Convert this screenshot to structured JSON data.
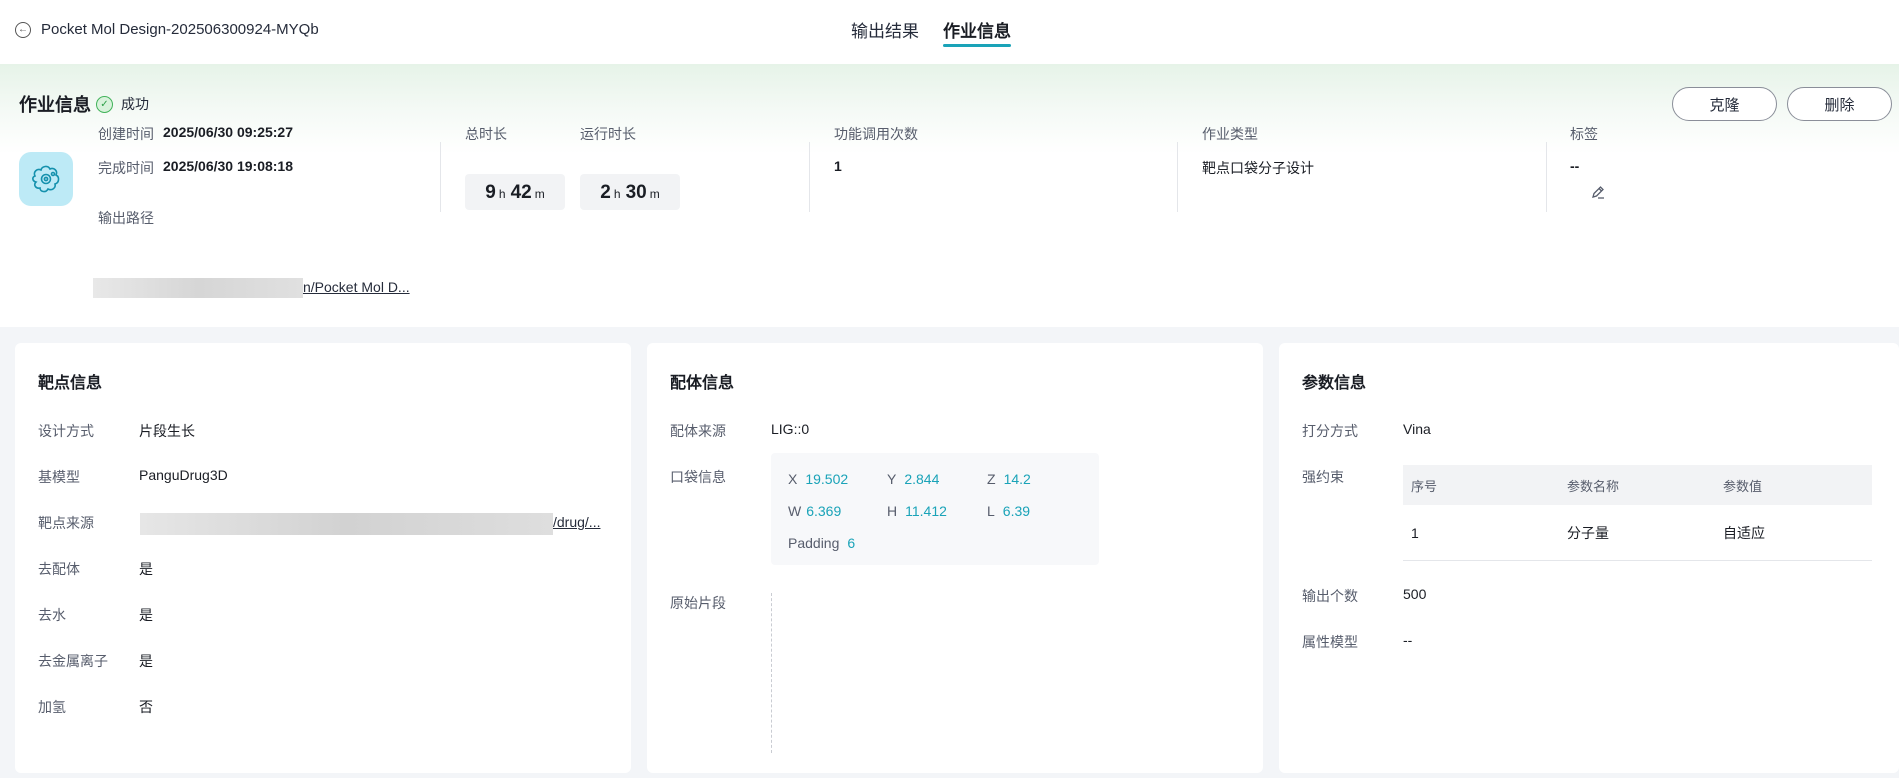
{
  "header": {
    "title": "Pocket Mol Design-202506300924-MYQb",
    "tabs": [
      {
        "label": "输出结果",
        "active": false
      },
      {
        "label": "作业信息",
        "active": true
      }
    ]
  },
  "job": {
    "title": "作业信息",
    "status": "成功",
    "actions": {
      "clone": "克隆",
      "delete": "删除"
    },
    "created_label": "创建时间",
    "created_value": "2025/06/30 09:25:27",
    "finished_label": "完成时间",
    "finished_value": "2025/06/30 19:08:18",
    "total_label": "总时长",
    "total": {
      "h": "9",
      "m": "42",
      "h_unit": "h",
      "m_unit": "m"
    },
    "run_label": "运行时长",
    "run": {
      "h": "2",
      "m": "30",
      "h_unit": "h",
      "m_unit": "m"
    },
    "calls_label": "功能调用次数",
    "calls_value": "1",
    "type_label": "作业类型",
    "type_value": "靶点口袋分子设计",
    "tag_label": "标签",
    "tag_value": "--",
    "output_label": "输出路径",
    "output_value": "n/Pocket Mol D..."
  },
  "target": {
    "title": "靶点信息",
    "rows": [
      {
        "label": "设计方式",
        "value": "片段生长"
      },
      {
        "label": "基模型",
        "value": "PanguDrug3D"
      },
      {
        "label": "靶点来源",
        "value": "/drug/..."
      },
      {
        "label": "去配体",
        "value": "是"
      },
      {
        "label": "去水",
        "value": "是"
      },
      {
        "label": "去金属离子",
        "value": "是"
      },
      {
        "label": "加氢",
        "value": "否"
      }
    ]
  },
  "ligand": {
    "title": "配体信息",
    "source_label": "配体来源",
    "source_value": "LIG::0",
    "pocket_label": "口袋信息",
    "pocket": {
      "x_label": "X",
      "x": "19.502",
      "y_label": "Y",
      "y": "2.844",
      "z_label": "Z",
      "z": "14.2",
      "w_label": "W",
      "w": "6.369",
      "h_label": "H",
      "h": "11.412",
      "l_label": "L",
      "l": "6.39",
      "padding_label": "Padding",
      "padding": "6"
    },
    "fragment_label": "原始片段"
  },
  "params": {
    "title": "参数信息",
    "scoring_label": "打分方式",
    "scoring_value": "Vina",
    "constraint_label": "强约束",
    "table": {
      "headers": [
        "序号",
        "参数名称",
        "参数值"
      ],
      "rows": [
        [
          "1",
          "分子量",
          "自适应"
        ]
      ]
    },
    "output_count_label": "输出个数",
    "output_count_value": "500",
    "property_model_label": "属性模型",
    "property_model_value": "--"
  },
  "colors": {
    "accent": "#1aa3b8",
    "success": "#41b35a"
  }
}
